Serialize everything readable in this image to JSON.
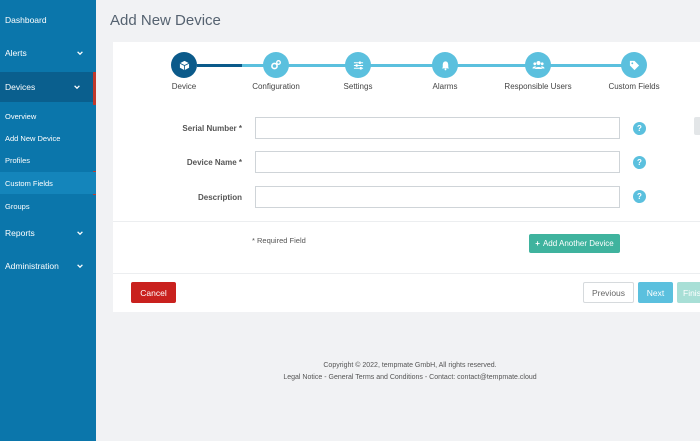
{
  "sidebar": {
    "items": [
      {
        "label": "Dashboard"
      },
      {
        "label": "Alerts"
      },
      {
        "label": "Devices"
      },
      {
        "label": "Reports"
      },
      {
        "label": "Administration"
      }
    ],
    "devices_sub": [
      {
        "label": "Overview"
      },
      {
        "label": "Add New Device"
      },
      {
        "label": "Profiles"
      },
      {
        "label": "Custom Fields"
      },
      {
        "label": "Groups"
      }
    ]
  },
  "page": {
    "title": "Add New Device"
  },
  "steps": [
    {
      "label": "Device",
      "icon": "cube-icon"
    },
    {
      "label": "Configuration",
      "icon": "gears-icon"
    },
    {
      "label": "Settings",
      "icon": "sliders-icon"
    },
    {
      "label": "Alarms",
      "icon": "bell-icon"
    },
    {
      "label": "Responsible Users",
      "icon": "users-icon"
    },
    {
      "label": "Custom Fields",
      "icon": "tags-icon"
    }
  ],
  "form": {
    "serial_label": "Serial Number *",
    "name_label": "Device Name *",
    "description_label": "Description",
    "serial_value": "",
    "name_value": "",
    "description_value": "",
    "help_glyph": "?"
  },
  "actions": {
    "required_note": "* Required Field",
    "add_another": "Add Another Device",
    "cancel": "Cancel",
    "previous": "Previous",
    "next": "Next",
    "finish": "Finish"
  },
  "footer": {
    "copyright": "Copyright © 2022, tempmate GmbH, All rights reserved.",
    "legal": "Legal Notice",
    "sep1": " - ",
    "terms": "General Terms and Conditions",
    "sep2": " - Contact: ",
    "contact": "contact@tempmate.cloud"
  },
  "colors": {
    "sidebar": "#0b76ab",
    "step_active": "#0b5a8a",
    "step": "#5bc0de",
    "cancel": "#c9211e",
    "add": "#3fb39e"
  }
}
